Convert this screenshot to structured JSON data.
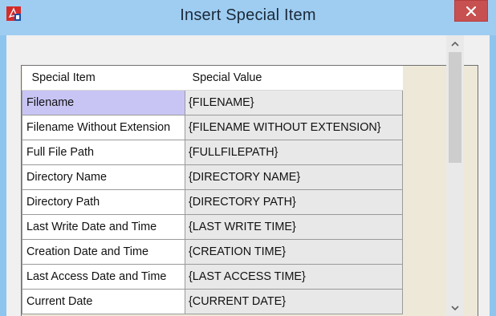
{
  "window": {
    "title": "Insert Special Item"
  },
  "grid": {
    "headers": [
      "Special Item",
      "Special Value"
    ],
    "rows": [
      {
        "item": "Filename",
        "value": "{FILENAME}"
      },
      {
        "item": "Filename Without Extension",
        "value": "{FILENAME WITHOUT EXTENSION}"
      },
      {
        "item": "Full File Path",
        "value": "{FULLFILEPATH}"
      },
      {
        "item": "Directory Name",
        "value": "{DIRECTORY NAME}"
      },
      {
        "item": "Directory Path",
        "value": "{DIRECTORY PATH}"
      },
      {
        "item": "Last Write Date and Time",
        "value": "{LAST WRITE TIME}"
      },
      {
        "item": "Creation Date and Time",
        "value": "{CREATION TIME}"
      },
      {
        "item": "Last Access Date and Time",
        "value": "{LAST ACCESS TIME}"
      },
      {
        "item": "Current Date",
        "value": "{CURRENT DATE}"
      }
    ],
    "selected_row": "Filename"
  },
  "icons": {
    "app": "pdf-app-icon",
    "close": "close-icon",
    "scroll_up": "chevron-up-icon",
    "scroll_down": "chevron-down-icon"
  },
  "colors": {
    "title_bar": "#9fcdf1",
    "close_button": "#c75050",
    "selected_row": "#c8c5f5",
    "grid_background": "#ede8d8"
  }
}
